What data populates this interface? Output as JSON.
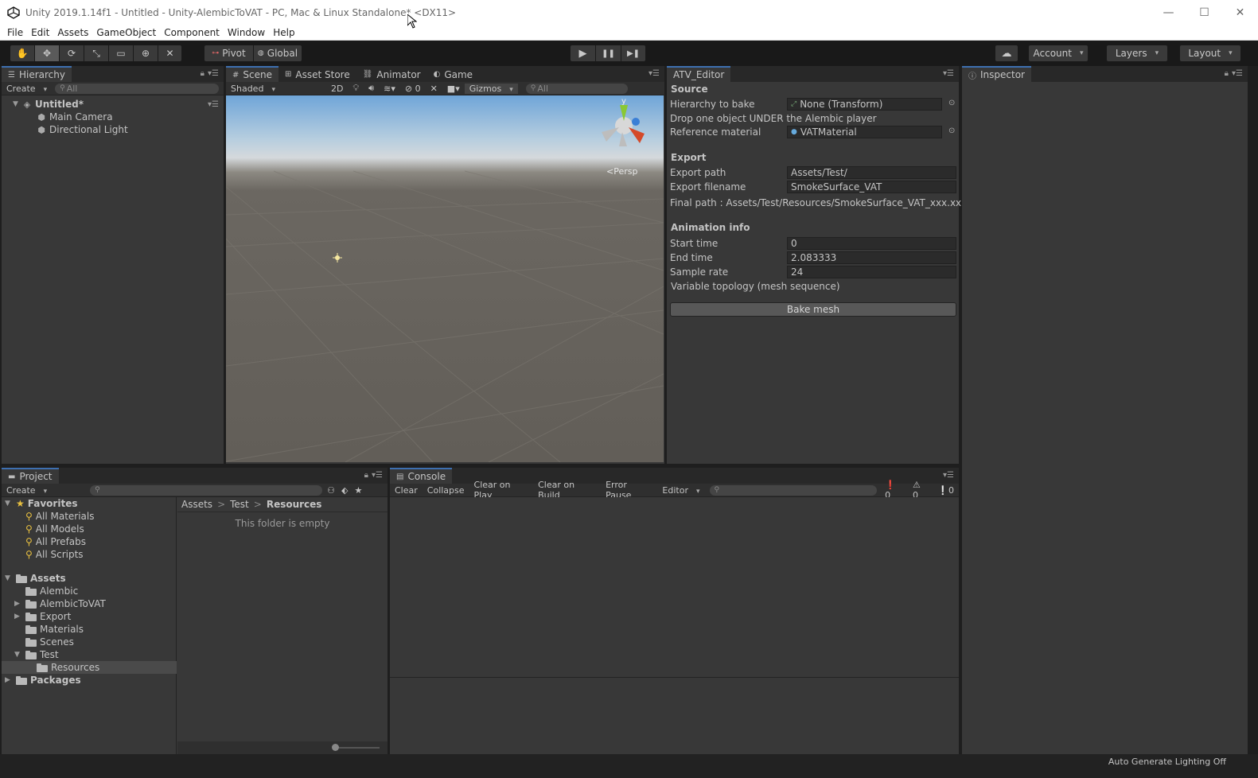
{
  "window": {
    "title": "Unity 2019.1.14f1 - Untitled - Unity-AlembicToVAT - PC, Mac & Linux Standalone* <DX11>",
    "controls": {
      "minimize": "—",
      "maximize": "☐",
      "close": "✕"
    }
  },
  "menu": [
    "File",
    "Edit",
    "Assets",
    "GameObject",
    "Component",
    "Window",
    "Help"
  ],
  "toolbar": {
    "tools": [
      "hand-icon",
      "move-icon",
      "rotate-icon",
      "scale-icon",
      "rect-icon",
      "transform-icon",
      "custom-tool-icon"
    ],
    "tool_glyphs": [
      "✋",
      "✥",
      "⟳",
      "⤡",
      "▭",
      "⊕",
      "✕"
    ],
    "pivot": "Pivot",
    "global": "Global",
    "play": "▶",
    "pause": "❚❚",
    "step": "▶❚",
    "collab_icon": "☁",
    "account": "Account",
    "layers": "Layers",
    "layout": "Layout"
  },
  "hierarchy": {
    "tab": "Hierarchy",
    "create": "Create",
    "search_placeholder": "All",
    "scene": "Untitled*",
    "items": [
      "Main Camera",
      "Directional Light"
    ]
  },
  "scene_tabs": [
    {
      "label": "Scene",
      "icon": "#"
    },
    {
      "label": "Asset Store",
      "icon": "⊞"
    },
    {
      "label": "Animator",
      "icon": "⛓"
    },
    {
      "label": "Game",
      "icon": "◐"
    }
  ],
  "scene_toolbar": {
    "shading": "Shaded",
    "mode_2d": "2D",
    "hidden_count": "0",
    "gizmos": "Gizmos",
    "search_placeholder": "All"
  },
  "gizmo": {
    "y_label": "y",
    "persp": "Persp"
  },
  "atv_editor": {
    "tab": "ATV_Editor",
    "source_header": "Source",
    "hierarchy_label": "Hierarchy to bake",
    "hierarchy_value": "None (Transform)",
    "drop_hint": "Drop one object UNDER the Alembic player",
    "ref_material_label": "Reference material",
    "ref_material_value": "VATMaterial",
    "export_header": "Export",
    "export_path_label": "Export path",
    "export_path_value": "Assets/Test/",
    "export_filename_label": "Export filename",
    "export_filename_value": "SmokeSurface_VAT",
    "final_path": "Final path : Assets/Test/Resources/SmokeSurface_VAT_xxx.xx",
    "anim_header": "Animation info",
    "start_time_label": "Start time",
    "start_time_value": "0",
    "end_time_label": "End time",
    "end_time_value": "2.083333",
    "sample_rate_label": "Sample rate",
    "sample_rate_value": "24",
    "variable_topology": "Variable topology (mesh sequence)",
    "bake_button": "Bake mesh"
  },
  "inspector": {
    "tab": "Inspector"
  },
  "project": {
    "tab": "Project",
    "create": "Create",
    "favorites_header": "Favorites",
    "favorites": [
      "All Materials",
      "All Models",
      "All Prefabs",
      "All Scripts"
    ],
    "assets_header": "Assets",
    "assets": [
      "Alembic",
      "AlembicToVAT",
      "Export",
      "Materials",
      "Scenes",
      "Test"
    ],
    "test_child": "Resources",
    "packages": "Packages",
    "breadcrumb": [
      "Assets",
      "Test",
      "Resources"
    ],
    "breadcrumb_sep": ">",
    "empty_msg": "This folder is empty"
  },
  "console": {
    "tab": "Console",
    "buttons": [
      "Clear",
      "Collapse",
      "Clear on Play",
      "Clear on Build",
      "Error Pause",
      "Editor"
    ],
    "count_errors": "0",
    "count_warnings": "0",
    "count_messages": "0"
  },
  "status": {
    "lighting": "Auto Generate Lighting Off"
  }
}
